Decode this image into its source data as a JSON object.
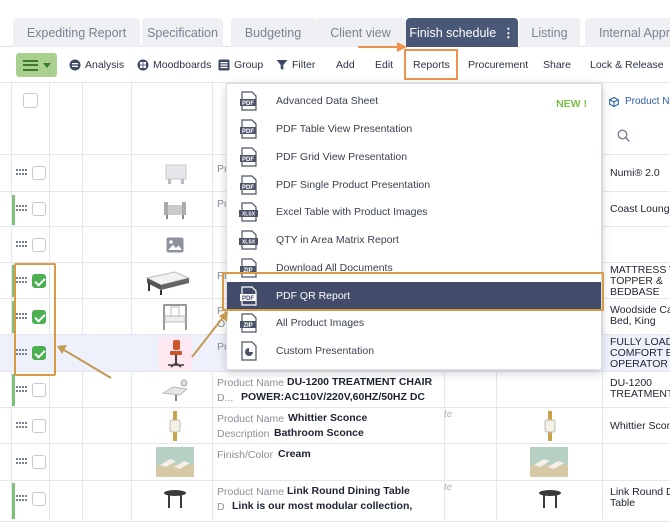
{
  "tabs": [
    {
      "label": "Expediting Report"
    },
    {
      "label": "Specification"
    },
    {
      "label": "Budgeting"
    },
    {
      "label": "Client view"
    },
    {
      "label": "Finish schedule",
      "dots": "⋮"
    },
    {
      "label": "Listing"
    },
    {
      "label": "Internal Appro"
    }
  ],
  "toolbar": {
    "analysis": "Analysis",
    "moodboards": "Moodboards",
    "group": "Group",
    "filter": "Filter",
    "add": "Add",
    "edit": "Edit",
    "reports": "Reports",
    "procurement": "Procurement",
    "share": "Share",
    "lock_release": "Lock & Release"
  },
  "header": {
    "right_column": "Product N"
  },
  "dropdown": {
    "new_badge": "NEW !",
    "items": [
      {
        "icon": "PDF",
        "label": "Advanced Data Sheet"
      },
      {
        "icon": "PDF",
        "label": "PDF Table View Presentation"
      },
      {
        "icon": "PDF",
        "label": "PDF Grid View Presentation"
      },
      {
        "icon": "PDF",
        "label": "PDF Single Product Presentation"
      },
      {
        "icon": "XLSX",
        "label": "Excel Table with Product Images"
      },
      {
        "icon": "XLSX",
        "label": "QTY in Area Matrix Report"
      },
      {
        "icon": "ZIP",
        "label": "Download All Documents"
      },
      {
        "icon": "PDF",
        "label": "PDF QR Report"
      },
      {
        "icon": "ZIP",
        "label": "All Product Images"
      },
      {
        "icon": "",
        "label": "Custom Presentation"
      }
    ]
  },
  "rows": [
    {
      "lbl1": "Pr",
      "right": [
        "Numi® 2.0"
      ]
    },
    {
      "lbl1": "Pr",
      "right": [
        "Coast Loung"
      ]
    },
    {
      "lbl1": "",
      "right": []
    },
    {
      "lbl1": "Pr",
      "right": [
        "MATTRESS W",
        "TOPPER &",
        "BEDBASE"
      ]
    },
    {
      "lbl1": "Pr",
      "lbl2": "O",
      "right": [
        "Woodside Ca",
        "Bed, King"
      ]
    },
    {
      "lbl1": "Pr",
      "right": [
        "FULLY LOAD",
        "COMFORT E",
        "OPERATOR C"
      ]
    },
    {
      "lbl1": "Product Name",
      "val1": "DU-1200 TREATMENT CHAIR",
      "lbl2": "D...",
      "val2": "POWER:AC110V/220V,60HZ/50HZ DC",
      "right": [
        "DU-1200",
        "TREATMENT"
      ]
    },
    {
      "lbl1": "Product Name",
      "val1": "Whittier Sconce",
      "lbl2": "Description",
      "val2": "Bathroom Sconce",
      "right": [
        "Whittier Scon"
      ]
    },
    {
      "lbl1": "Finish/Color",
      "val1": "Cream",
      "right": []
    },
    {
      "lbl1": "Product Name",
      "val1": "Link Round Dining Table",
      "lbl2": "D",
      "val2": "Link is our most modular collection,",
      "right": [
        "Link Round D",
        "Table"
      ]
    }
  ],
  "ghost_text": "te",
  "colors": {
    "active_tab": "#4a5878",
    "highlight_orange": "#d89a42",
    "arrow_orange": "#f0934a",
    "check_green": "#4caf50",
    "new_green": "#7cc04a",
    "menu_active": "#424c6a"
  }
}
